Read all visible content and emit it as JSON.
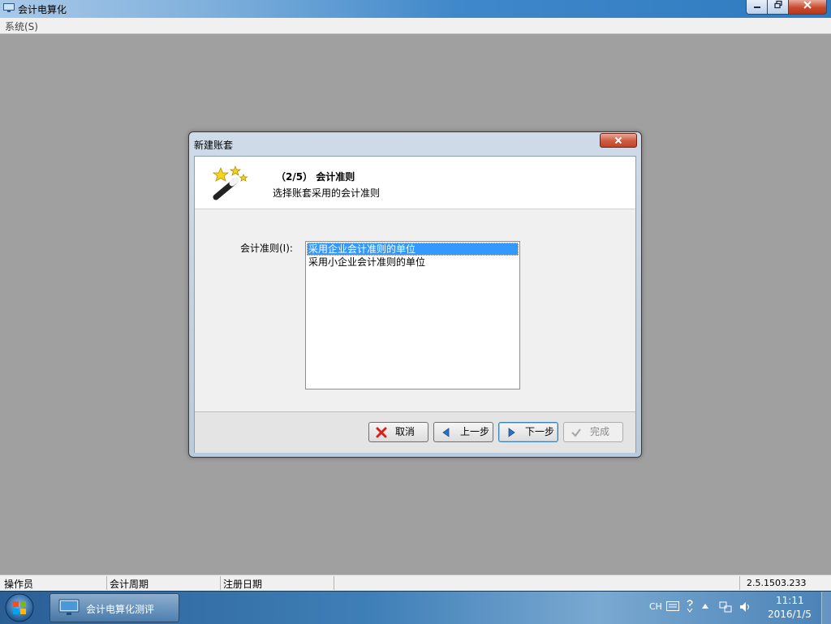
{
  "app": {
    "title": "会计电算化",
    "menu": [
      "系统(S)"
    ]
  },
  "dialog": {
    "title": "新建账套",
    "close_label": "x",
    "step_title": "（2/5） 会计准则",
    "step_subtitle": "选择账套采用的会计准则",
    "field_label": "会计准则(I):",
    "options": [
      "采用企业会计准则的单位",
      "采用小企业会计准则的单位"
    ],
    "selected_index": 0,
    "buttons": {
      "cancel": "取消",
      "prev": "上一步",
      "next": "下一步",
      "finish": "完成"
    }
  },
  "statusbar": {
    "operator": "操作员",
    "period": "会计周期",
    "reg_date": "注册日期",
    "version": "2.5.1503.233"
  },
  "taskbar": {
    "task_label": "会计电算化测评",
    "ime": "CH",
    "time": "11:11",
    "date": "2016/1/5"
  },
  "colors": {
    "selection": "#3399ff",
    "workspace": "#a0a0a0"
  }
}
